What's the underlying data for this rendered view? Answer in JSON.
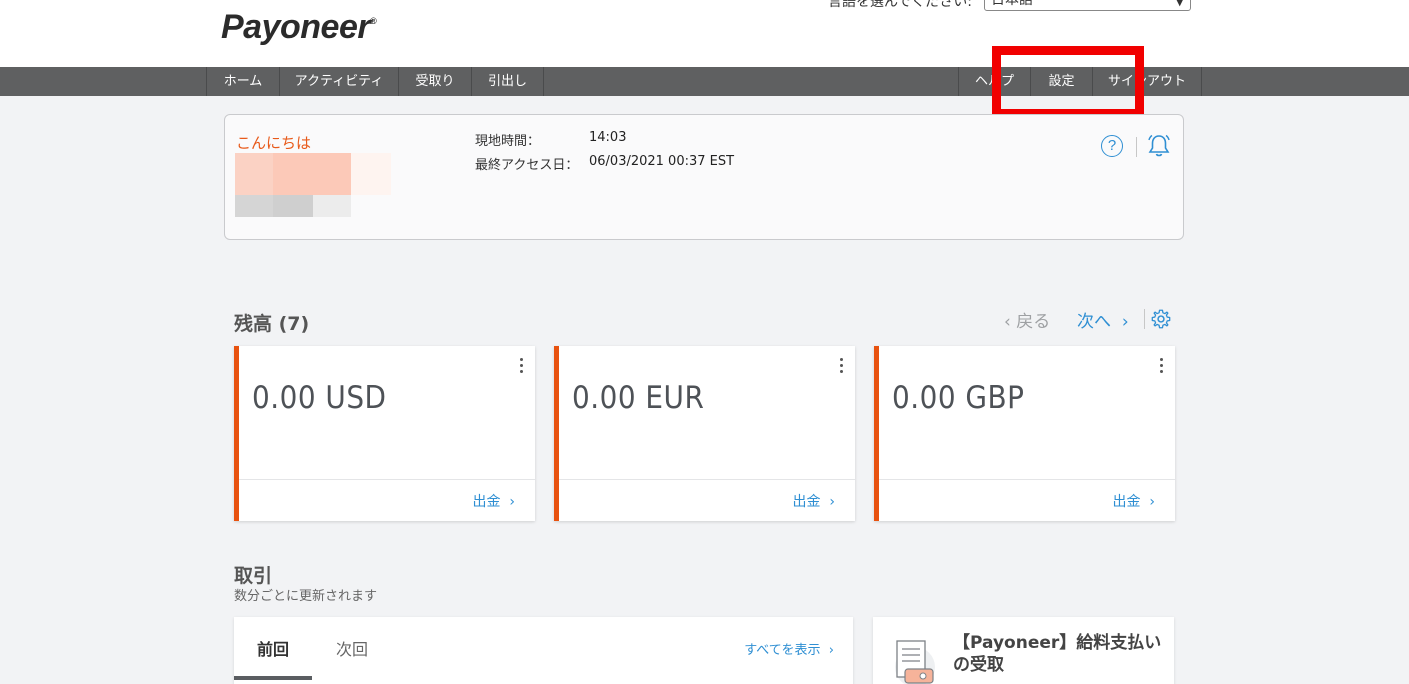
{
  "header": {
    "logo_text": "Payoneer",
    "logo_brand_color": "#e8520f",
    "language_label": "言語を選んでください:",
    "language_value": "日本語"
  },
  "nav": {
    "items": [
      "ホーム",
      "アクティビティ",
      "受取り",
      "引出し"
    ],
    "right_items": [
      "ヘルプ",
      "設定",
      "サインアウト"
    ]
  },
  "welcome": {
    "greeting": "こんにちは",
    "local_time_label": "現地時間：",
    "local_time_value": "14:03",
    "last_access_label": "最終アクセス日：",
    "last_access_value": "06/03/2021 00:37 EST"
  },
  "balances": {
    "title": "残高 (7)",
    "prev_label": "戻る",
    "next_label": "次へ",
    "cards": [
      {
        "amount": "0.00 USD",
        "action": "出金"
      },
      {
        "amount": "0.00 EUR",
        "action": "出金"
      },
      {
        "amount": "0.00 GBP",
        "action": "出金"
      }
    ]
  },
  "transactions": {
    "title": "取引",
    "subtitle": "数分ごとに更新されます",
    "tabs": [
      "前回",
      "次回"
    ],
    "show_all": "すべてを表示"
  },
  "promo": {
    "title": "【Payoneer】給料支払いの受取"
  },
  "colors": {
    "accent_orange": "#e8520f",
    "link_blue": "#2f8fd3",
    "nav_bg": "#5f6061",
    "highlight_red": "#f10000"
  }
}
